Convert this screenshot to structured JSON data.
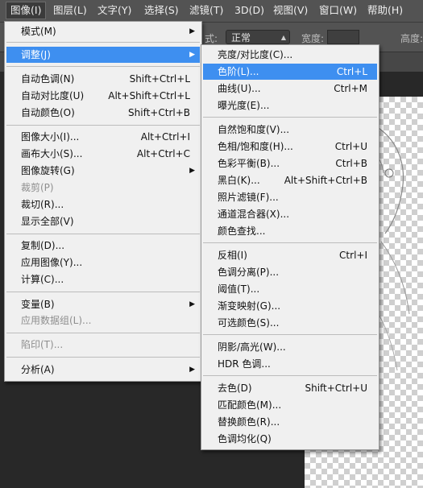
{
  "menubar": {
    "items": [
      {
        "label": "图像(I)"
      },
      {
        "label": "图层(L)"
      },
      {
        "label": "文字(Y)"
      },
      {
        "label": "选择(S)"
      },
      {
        "label": "滤镜(T)"
      },
      {
        "label": "3D(D)"
      },
      {
        "label": "视图(V)"
      },
      {
        "label": "窗口(W)"
      },
      {
        "label": "帮助(H)"
      }
    ]
  },
  "options_bar": {
    "style_label": "式:",
    "style_value": "正常",
    "width_label": "宽度:",
    "height_label": "高度:"
  },
  "image_menu": {
    "items": [
      {
        "label": "模式(M)",
        "shortcut": "",
        "submenu": true
      },
      {
        "label": "调整(J)",
        "shortcut": "",
        "submenu": true,
        "highlighted": true
      },
      {
        "label": "自动色调(N)",
        "shortcut": "Shift+Ctrl+L"
      },
      {
        "label": "自动对比度(U)",
        "shortcut": "Alt+Shift+Ctrl+L"
      },
      {
        "label": "自动颜色(O)",
        "shortcut": "Shift+Ctrl+B"
      },
      {
        "label": "图像大小(I)...",
        "shortcut": "Alt+Ctrl+I"
      },
      {
        "label": "画布大小(S)...",
        "shortcut": "Alt+Ctrl+C"
      },
      {
        "label": "图像旋转(G)",
        "shortcut": "",
        "submenu": true
      },
      {
        "label": "裁剪(P)",
        "shortcut": "",
        "disabled": true
      },
      {
        "label": "裁切(R)...",
        "shortcut": ""
      },
      {
        "label": "显示全部(V)",
        "shortcut": ""
      },
      {
        "label": "复制(D)...",
        "shortcut": ""
      },
      {
        "label": "应用图像(Y)...",
        "shortcut": ""
      },
      {
        "label": "计算(C)...",
        "shortcut": ""
      },
      {
        "label": "变量(B)",
        "shortcut": "",
        "submenu": true
      },
      {
        "label": "应用数据组(L)...",
        "shortcut": "",
        "disabled": true
      },
      {
        "label": "陷印(T)...",
        "shortcut": "",
        "disabled": true
      },
      {
        "label": "分析(A)",
        "shortcut": "",
        "submenu": true
      }
    ]
  },
  "adjust_menu": {
    "items": [
      {
        "label": "亮度/对比度(C)...",
        "shortcut": ""
      },
      {
        "label": "色阶(L)...",
        "shortcut": "Ctrl+L",
        "highlighted": true
      },
      {
        "label": "曲线(U)...",
        "shortcut": "Ctrl+M"
      },
      {
        "label": "曝光度(E)...",
        "shortcut": ""
      },
      {
        "label": "自然饱和度(V)...",
        "shortcut": ""
      },
      {
        "label": "色相/饱和度(H)...",
        "shortcut": "Ctrl+U"
      },
      {
        "label": "色彩平衡(B)...",
        "shortcut": "Ctrl+B"
      },
      {
        "label": "黑白(K)...",
        "shortcut": "Alt+Shift+Ctrl+B"
      },
      {
        "label": "照片滤镜(F)...",
        "shortcut": ""
      },
      {
        "label": "通道混合器(X)...",
        "shortcut": ""
      },
      {
        "label": "颜色查找...",
        "shortcut": ""
      },
      {
        "label": "反相(I)",
        "shortcut": "Ctrl+I"
      },
      {
        "label": "色调分离(P)...",
        "shortcut": ""
      },
      {
        "label": "阈值(T)...",
        "shortcut": ""
      },
      {
        "label": "渐变映射(G)...",
        "shortcut": ""
      },
      {
        "label": "可选颜色(S)...",
        "shortcut": ""
      },
      {
        "label": "阴影/高光(W)...",
        "shortcut": ""
      },
      {
        "label": "HDR 色调...",
        "shortcut": ""
      },
      {
        "label": "去色(D)",
        "shortcut": "Shift+Ctrl+U"
      },
      {
        "label": "匹配颜色(M)...",
        "shortcut": ""
      },
      {
        "label": "替换颜色(R)...",
        "shortcut": ""
      },
      {
        "label": "色调均化(Q)",
        "shortcut": ""
      }
    ]
  },
  "colors": {
    "highlight": "#3e8ff0",
    "menu_bg": "#f0f0f0",
    "menubar_bg": "#535353"
  }
}
